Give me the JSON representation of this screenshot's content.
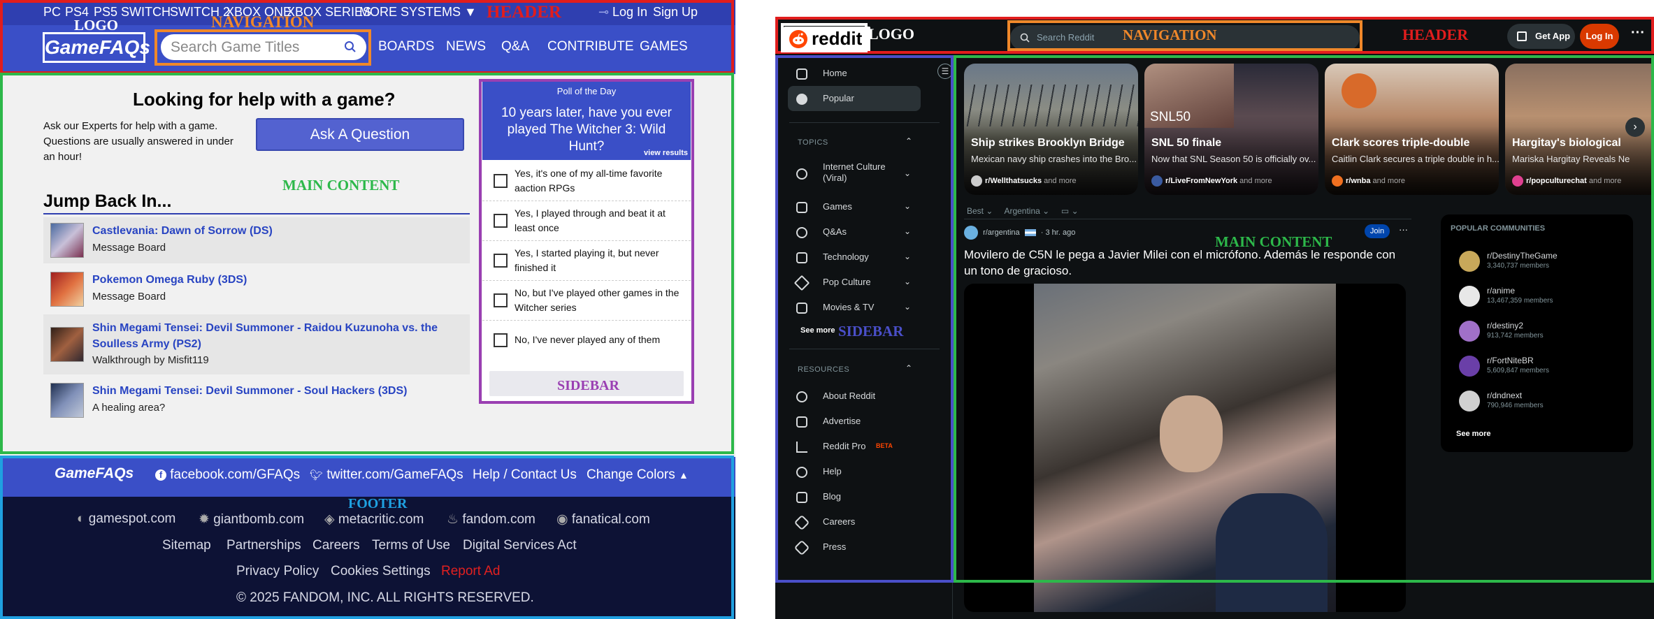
{
  "gamefaqs": {
    "platforms": [
      "PC",
      "PS4",
      "PS5",
      "SWITCH",
      "SWITCH 2",
      "XBOX ONE",
      "XBOX SERIES",
      "MORE SYSTEMS"
    ],
    "login": "Log In",
    "signup": "Sign Up",
    "logo": "GameFAQs",
    "search_placeholder": "Search Game Titles",
    "nav": [
      "BOARDS",
      "NEWS",
      "Q&A",
      "CONTRIBUTE",
      "GAMES"
    ],
    "help_heading": "Looking for help with a game?",
    "help_text": "Ask our Experts for help with a game. Questions are usually answered in under an hour!",
    "ask_button": "Ask A Question",
    "jump_heading": "Jump Back In...",
    "jump_items": [
      {
        "title": "Castlevania: Dawn of Sorrow (DS)",
        "sub": "Message Board"
      },
      {
        "title": "Pokemon Omega Ruby (3DS)",
        "sub": "Message Board"
      },
      {
        "title": "Shin Megami Tensei: Devil Summoner - Raidou Kuzunoha vs. the Soulless Army (PS2)",
        "sub": "Walkthrough by Misfit119"
      },
      {
        "title": "Shin Megami Tensei: Devil Summoner - Soul Hackers (3DS)",
        "sub": "A healing area?"
      }
    ],
    "poll": {
      "label": "Poll of the Day",
      "question": "10 years later, have you ever played The Witcher 3: Wild Hunt?",
      "view_results": "view results",
      "options": [
        "Yes, it's one of my all-time favorite aaction RPGs",
        "Yes, I played through and beat it at least once",
        "Yes, I started playing it, but never finished it",
        "No, but I've played other games in the Witcher series",
        "No, I've never played any of them"
      ]
    },
    "footer_top": {
      "logo": "GameFAQs",
      "facebook": "facebook.com/GFAQs",
      "twitter": "twitter.com/GameFAQs",
      "help": "Help / Contact Us",
      "colors": "Change Colors"
    },
    "footer_sites": [
      "gamespot.com",
      "giantbomb.com",
      "metacritic.com",
      "fandom.com",
      "fanatical.com"
    ],
    "footer_links": [
      "Sitemap",
      "Partnerships",
      "Careers",
      "Terms of Use",
      "Digital Services Act"
    ],
    "footer_links2": [
      "Privacy Policy",
      "Cookies Settings",
      "Report Ad"
    ],
    "copyright": "© 2025 FANDOM, INC. ALL RIGHTS RESERVED.",
    "report_ad_color": "#e02020"
  },
  "reddit": {
    "logo": "reddit",
    "search_placeholder": "Search Reddit",
    "get_app": "Get App",
    "login": "Log In",
    "more": "···",
    "sidebar": {
      "home": "Home",
      "popular": "Popular",
      "topics_label": "TOPICS",
      "topics": [
        "Internet Culture (Viral)",
        "Games",
        "Q&As",
        "Technology",
        "Pop Culture",
        "Movies & TV"
      ],
      "see_more": "See more",
      "resources_label": "RESOURCES",
      "resources": [
        "About Reddit",
        "Advertise",
        "Reddit Pro",
        "Help",
        "Blog",
        "Careers",
        "Press"
      ],
      "beta": "BETA"
    },
    "cards": [
      {
        "title": "Ship strikes Brooklyn Bridge",
        "sub": "Mexican navy ship crashes into the Bro...",
        "community": "r/Wellthatsucks",
        "more": "and more"
      },
      {
        "title": "SNL 50 finale",
        "sub": "Now that SNL Season 50 is officially ov...",
        "community": "r/LiveFromNewYork",
        "more": "and more",
        "badge": "SNL50"
      },
      {
        "title": "Clark scores triple-double",
        "sub": "Caitlin Clark secures a triple double in h...",
        "community": "r/wnba",
        "more": "and more"
      },
      {
        "title": "Hargitay's biological",
        "sub": "Mariska Hargitay Reveals Ne",
        "community": "r/popculturechat",
        "more": "and more"
      }
    ],
    "sort": {
      "best": "Best",
      "region": "Argentina"
    },
    "post": {
      "subreddit": "r/argentina",
      "time": "· 3 hr. ago",
      "join": "Join",
      "more": "···",
      "title": "Movilero de C5N le pega a Javier Milei con el micrófono. Además le responde con un tono de gracioso."
    },
    "popular": {
      "heading": "POPULAR COMMUNITIES",
      "items": [
        {
          "name": "r/DestinyTheGame",
          "members": "3,340,737 members",
          "color": "#c8a85a"
        },
        {
          "name": "r/anime",
          "members": "13,467,359 members",
          "color": "#e8e8e8"
        },
        {
          "name": "r/destiny2",
          "members": "913,742 members",
          "color": "#a070c8"
        },
        {
          "name": "r/FortNiteBR",
          "members": "5,609,847 members",
          "color": "#6a3fa8"
        },
        {
          "name": "r/dndnext",
          "members": "790,946 members",
          "color": "#d0d0d0"
        }
      ],
      "see_more": "See more"
    }
  },
  "overlay": {
    "left": {
      "header": "HEADER",
      "logo": "LOGO",
      "navigation": "NAVIGATION",
      "main": "MAIN CONTENT",
      "sidebar": "SIDEBAR",
      "footer": "FOOTER"
    },
    "right": {
      "header": "HEADER",
      "logo": "LOGO",
      "navigation": "NAVIGATION",
      "main": "MAIN CONTENT",
      "sidebar": "SIDEBAR"
    },
    "colors": {
      "header": "#e11d1d",
      "navigation": "#f0882a",
      "main": "#2db84a",
      "sidebar": "#9a3fb2",
      "footer": "#1fa0e0",
      "logo": "#ffffff",
      "rd_sidebar": "#4a4fc8"
    }
  }
}
